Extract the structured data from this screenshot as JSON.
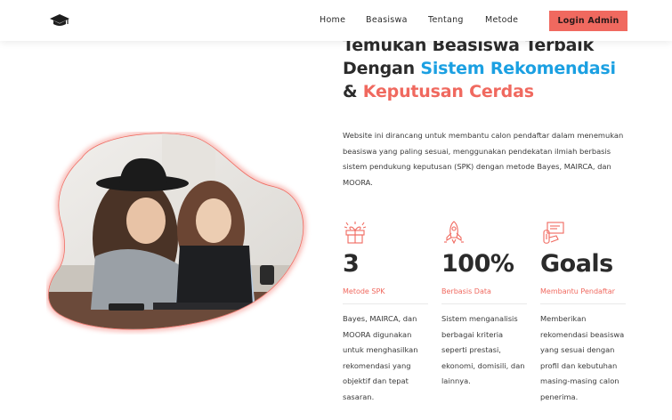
{
  "nav": {
    "items": [
      {
        "label": "Home"
      },
      {
        "label": "Beasiswa"
      },
      {
        "label": "Tentang"
      },
      {
        "label": "Metode"
      }
    ],
    "login_label": "Login Admin"
  },
  "hero": {
    "title_line1": "Temukan Beasiswa Terbaik",
    "title_line2_prefix": "Dengan ",
    "title_line2_highlight": "Sistem Rekomendasi",
    "title_line3_prefix": "& ",
    "title_line3_highlight": "Keputusan Cerdas",
    "description": "Website ini dirancang untuk membantu calon pendaftar dalam menemukan beasiswa yang paling sesuai, menggunakan pendekatan ilmiah berbasis sistem pendukung keputusan (SPK) dengan metode Bayes, MAIRCA, dan MOORA."
  },
  "stats": [
    {
      "icon": "gift-icon",
      "value": "3",
      "label": "Metode SPK",
      "text": "Bayes, MAIRCA, dan MOORA digunakan untuk menghasilkan rekomendasi yang objektif dan tepat sasaran."
    },
    {
      "icon": "rocket-icon",
      "value": "100%",
      "label": "Berbasis Data",
      "text": "Sistem menganalisis berbagai kriteria seperti prestasi, ekonomi, domisili, dan lainnya."
    },
    {
      "icon": "money-check-icon",
      "value": "Goals",
      "label": "Membantu Pendaftar",
      "text": "Memberikan rekomendasi beasiswa yang sesuai dengan profil dan kebutuhan masing-masing calon penerima."
    }
  ],
  "colors": {
    "accent": "#f0695f",
    "highlight_blue": "#1ba0e2",
    "text": "#2b2b2b"
  }
}
